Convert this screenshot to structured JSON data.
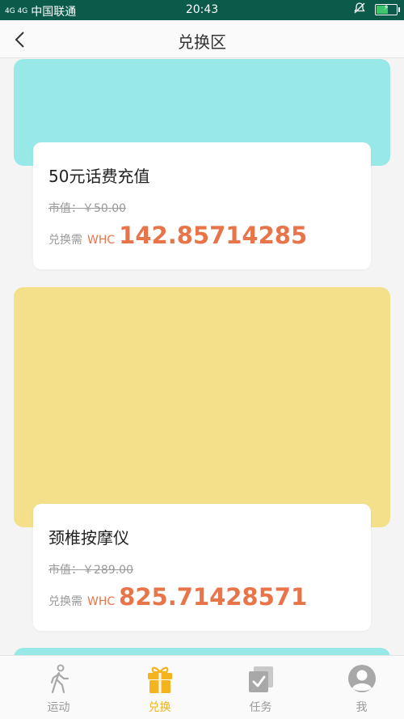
{
  "status_bar": {
    "signal": "4G 4G",
    "carrier": "中国联通",
    "time": "20:43",
    "battery_level": 0.55
  },
  "nav": {
    "title": "兑换区"
  },
  "products": [
    {
      "name": "50元话费充值",
      "market_price": "市值：￥50.00",
      "exchange_label": "兑换需",
      "exchange_unit": "WHC",
      "exchange_value": "142.85714285",
      "image_color": "#98e8e8"
    },
    {
      "name": "颈椎按摩仪",
      "market_price": "市值：￥289.00",
      "exchange_label": "兑换需",
      "exchange_unit": "WHC",
      "exchange_value": "825.71428571",
      "image_color": "#f4df8b"
    },
    {
      "image_color": "#98e8e8"
    }
  ],
  "tabs": [
    {
      "label": "运动",
      "icon": "walking-icon",
      "active": false
    },
    {
      "label": "兑换",
      "icon": "gift-icon",
      "active": true
    },
    {
      "label": "任务",
      "icon": "task-check-icon",
      "active": false
    },
    {
      "label": "我",
      "icon": "user-avatar-icon",
      "active": false
    }
  ],
  "colors": {
    "status_bar": "#0b5a4a",
    "accent_orange": "#e8744a",
    "tab_active": "#f3b41d"
  }
}
